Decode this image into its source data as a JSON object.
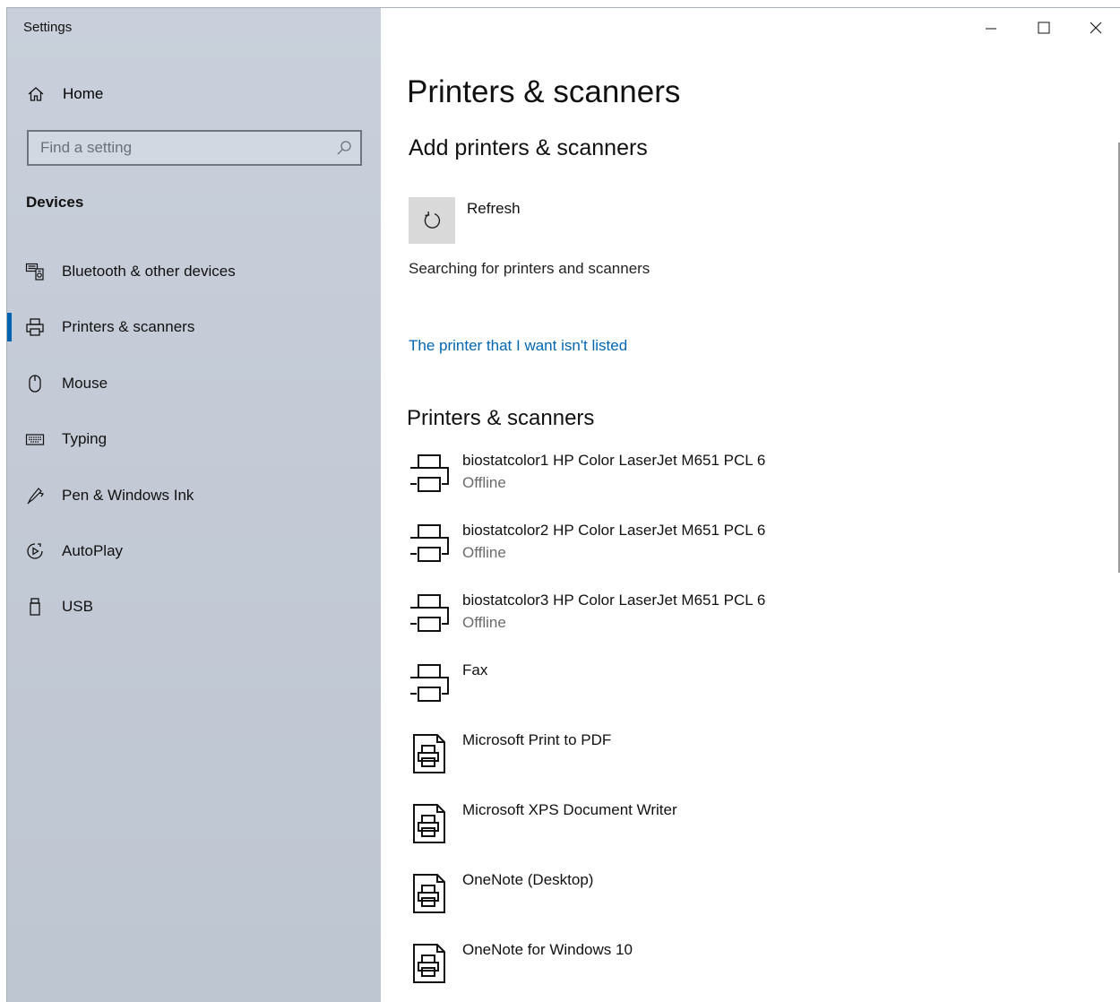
{
  "window": {
    "title": "Settings"
  },
  "sidebar": {
    "home_label": "Home",
    "search_placeholder": "Find a setting",
    "section_title": "Devices",
    "items": [
      {
        "label": "Bluetooth & other devices",
        "icon": "bluetooth-devices-icon"
      },
      {
        "label": "Printers & scanners",
        "icon": "printer-icon",
        "active": true
      },
      {
        "label": "Mouse",
        "icon": "mouse-icon"
      },
      {
        "label": "Typing",
        "icon": "keyboard-icon"
      },
      {
        "label": "Pen & Windows Ink",
        "icon": "pen-icon"
      },
      {
        "label": "AutoPlay",
        "icon": "autoplay-icon"
      },
      {
        "label": "USB",
        "icon": "usb-icon"
      }
    ]
  },
  "main": {
    "page_title": "Printers & scanners",
    "add_section": {
      "title": "Add printers & scanners",
      "refresh_label": "Refresh",
      "status": "Searching for printers and scanners",
      "link": "The printer that I want isn't listed"
    },
    "list_title": "Printers & scanners",
    "printers": [
      {
        "name": "biostatcolor1 HP Color LaserJet M651 PCL 6",
        "status": "Offline",
        "icon": "printer-icon"
      },
      {
        "name": "biostatcolor2 HP Color LaserJet M651 PCL 6",
        "status": "Offline",
        "icon": "printer-icon"
      },
      {
        "name": "biostatcolor3 HP Color LaserJet M651 PCL 6",
        "status": "Offline",
        "icon": "printer-icon"
      },
      {
        "name": "Fax",
        "status": "",
        "icon": "printer-icon"
      },
      {
        "name": "Microsoft Print to PDF",
        "status": "",
        "icon": "document-printer-icon"
      },
      {
        "name": "Microsoft XPS Document Writer",
        "status": "",
        "icon": "document-printer-icon"
      },
      {
        "name": "OneNote (Desktop)",
        "status": "",
        "icon": "document-printer-icon"
      },
      {
        "name": "OneNote for Windows 10",
        "status": "",
        "icon": "document-printer-icon"
      }
    ]
  },
  "colors": {
    "accent": "#0063b1",
    "link": "#0066b4",
    "sidebar_bg": "#c4cbd7"
  }
}
